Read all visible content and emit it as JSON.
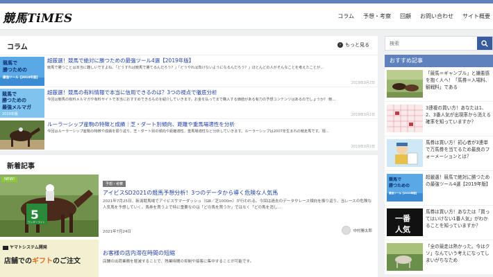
{
  "site": {
    "logo": "競馬TiMES"
  },
  "nav": [
    "コラム",
    "予想・考察",
    "回顧",
    "お問い合わせ",
    "サイト概要"
  ],
  "column": {
    "title": "コラム",
    "more": "もっと見る",
    "items": [
      {
        "title": "超厳選！競馬で絶対に勝つための最強ツール4選【2019年版】",
        "excerpt": "競馬で勝つことは本当に難しいですよね。「どうすれば競馬で勝てるんだろう？」「どうやれば負けないようになるんだろう？」ほとんどの人がそんなことを考えたことが…",
        "date": "2019年3月2日",
        "thumb_text": [
          "競馬で",
          "勝つための",
          "最強ツール【2019年版】"
        ]
      },
      {
        "title": "超厳選！競馬の有料情報で本当に信用できるのは？3つの視点で徹底分析",
        "excerpt": "今回は競馬の有料メルマガや有料サイトで本当におすすめできるものを紹介していきます。お金を払ってまで購入する価値がある有力の予想コンテンツはあるのでしょうか？ 競…",
        "date": "2019年3月2日",
        "thumb_text": [
          "競馬で",
          "勝つための",
          "最強メルマガ",
          "2019年版"
        ]
      },
      {
        "title": "ルーラーシップ産駒の特徴と成績｜芝・ダート別傾向、距離や重馬場適性を分析",
        "excerpt": "今回はルーラーシップ産駒の特徴や成績を振り返り、芝・ダート別の傾向や距離適性、重馬場適性など分析していきます。ルーラーシップは2007年生まれの競走馬です。現…",
        "date": "2019年3月2日"
      }
    ]
  },
  "newest": {
    "title": "新着記事",
    "items": [
      {
        "badge": "NEW!",
        "tag": "予想・考察",
        "title": "アイビスSD2021の競馬予想分析！3つのデータから導く危険な人気馬",
        "excerpt": "2021年7月25日、新潟競馬場でアイビスサマーダッシュ（GⅢ／芝1000m）が行われる。今回は過去のデータやレース傾向を振り返り、当レースの危険な人気馬を予想していく。馬券を買う上で特に重要なのは「どの馬を買うか」ではなく「どの馬を消し…",
        "date": "2021年7月24日",
        "author": "中村勝太郎",
        "saddle_number": "5",
        "saddle_text": "ワンダーライト"
      },
      {
        "title": "お客様の店内滞在時間の短縮",
        "excerpt": "店舗の出荷業務を軽減することで、残業時間の抑制や接客に集中することが可能です。",
        "thumb_brand": "ヤマトシステム開発",
        "thumb_text_a": "店舗で",
        "thumb_text_b": "の",
        "thumb_highlight": "ギフト",
        "thumb_text_c": "ご注文"
      }
    ]
  },
  "sidebar": {
    "search_placeholder": "検索",
    "title": "おすすめ記事",
    "items": [
      {
        "text": "「競馬＝ギャンブル」と嫌悪感を抱く人へ！「馬券＝入場料、観戦料」である"
      },
      {
        "text": "3連複の買い方！あなたは1、2、3番人気が出現率から消える確率を知っていますか？"
      },
      {
        "text": "馬券は買い方！初心者が3連単で万馬券を当てるため最良のフォーメーションとは？"
      },
      {
        "text": "超厳選！競馬で絶対に勝つための最強ツール4選【2019年版】",
        "thumb_text": [
          "競馬で",
          "勝つための",
          "最強ツール【2019年版】"
        ]
      },
      {
        "text": "馬券は買い方！あなたは「買ってはいけない1番人気」がわかることを知っていますか？",
        "thumb_text": [
          "一番",
          "人気"
        ]
      },
      {
        "text": "「全の競走は熱かった。今はクソ」なんていう考えになってしまいがちなため"
      }
    ]
  },
  "colors": {
    "accent": "#5f82bf",
    "link": "#1f3fa8",
    "badge": "#8dc63f",
    "search_button": "#395c9e"
  }
}
